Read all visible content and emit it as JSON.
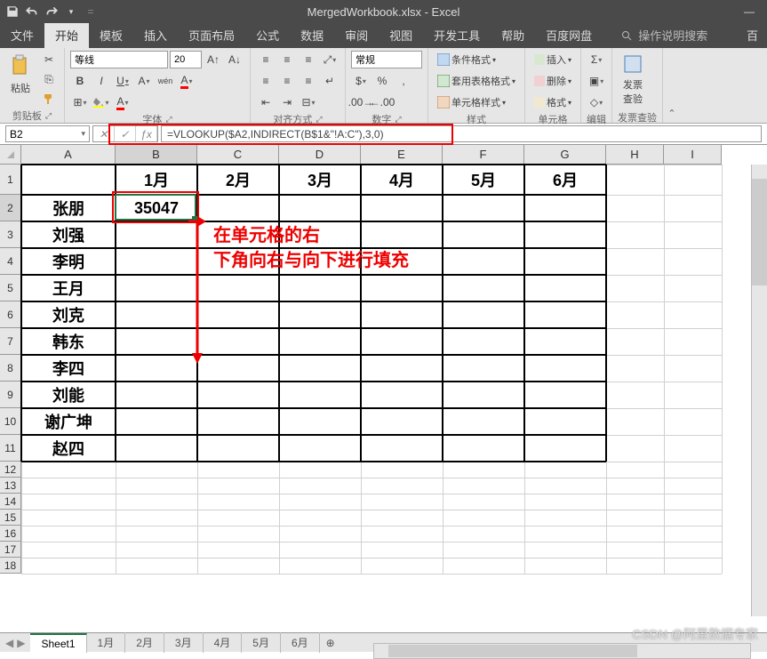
{
  "titlebar": {
    "title": "MergedWorkbook.xlsx - Excel"
  },
  "tabs": {
    "file": "文件",
    "home": "开始",
    "template": "模板",
    "insert": "插入",
    "pagelayout": "页面布局",
    "formulas": "公式",
    "data": "数据",
    "review": "审阅",
    "view": "视图",
    "developer": "开发工具",
    "help": "帮助",
    "baidudisk": "百度网盘",
    "tellme": "操作说明搜索",
    "baifen": "百"
  },
  "ribbon": {
    "clipboard": {
      "paste": "粘贴",
      "label": "剪贴板"
    },
    "font": {
      "name": "等线",
      "size": "20",
      "label": "字体",
      "bold": "B",
      "italic": "I",
      "underline": "U"
    },
    "alignment": {
      "label": "对齐方式"
    },
    "number": {
      "format": "常规",
      "label": "数字"
    },
    "styles": {
      "cond": "条件格式",
      "table": "套用表格格式",
      "cell": "单元格样式",
      "label": "样式"
    },
    "cells": {
      "insert": "插入",
      "delete": "删除",
      "format": "格式",
      "label": "单元格"
    },
    "editing": {
      "label": "编辑"
    },
    "invoice": {
      "btn": "发票\n查验",
      "label": "发票查验"
    }
  },
  "namebox": "B2",
  "formula": "=VLOOKUP($A2,INDIRECT(B$1&\"!A:C\"),3,0)",
  "cols": [
    "A",
    "B",
    "C",
    "D",
    "E",
    "F",
    "G",
    "H",
    "I"
  ],
  "row_count": 18,
  "headers": [
    "1月",
    "2月",
    "3月",
    "4月",
    "5月",
    "6月"
  ],
  "names": [
    "张朋",
    "刘强",
    "李明",
    "王月",
    "刘克",
    "韩东",
    "李四",
    "刘能",
    "谢广坤",
    "赵四"
  ],
  "b2_value": "35047",
  "annotation": {
    "line1": "在单元格的右",
    "line2": "下角向右与向下进行填充"
  },
  "sheets": {
    "active": "Sheet1",
    "others": [
      "1月",
      "2月",
      "3月",
      "4月",
      "5月",
      "6月"
    ]
  },
  "watermark": "CSDN @阿里数据专家"
}
